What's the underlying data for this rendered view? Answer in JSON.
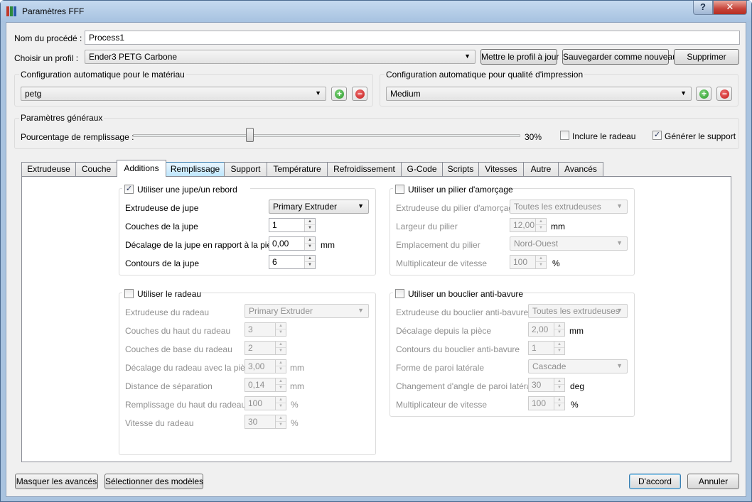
{
  "window": {
    "title": "Paramètres FFF",
    "help_label": "?",
    "close_label": "✕",
    "icon_colors": [
      "#c0392b",
      "#2e8b3d",
      "#2a5aa8"
    ]
  },
  "process": {
    "name_label": "Nom du procédé :",
    "name_value": "Process1",
    "profile_label": "Choisir un profil :",
    "profile_value": "Ender3 PETG Carbone",
    "update_button": "Mettre le profil à jour",
    "save_new_button": "Sauvegarder comme nouveau",
    "delete_button": "Supprimer"
  },
  "material": {
    "title": "Configuration automatique pour le matériau",
    "value": "petg"
  },
  "quality": {
    "title": "Configuration automatique pour qualité d'impression",
    "value": "Medium"
  },
  "general": {
    "title": "Paramètres généraux",
    "infill_label": "Pourcentage de remplissage :",
    "infill_value": "30%",
    "infill_percent": 30,
    "raft_label": "Inclure le radeau",
    "raft_checked": false,
    "support_label": "Générer le support",
    "support_checked": true
  },
  "tabs": [
    {
      "label": "Extrudeuse"
    },
    {
      "label": "Couche"
    },
    {
      "label": "Additions"
    },
    {
      "label": "Remplissage"
    },
    {
      "label": "Support"
    },
    {
      "label": "Température"
    },
    {
      "label": "Refroidissement"
    },
    {
      "label": "G-Code"
    },
    {
      "label": "Scripts"
    },
    {
      "label": "Vitesses"
    },
    {
      "label": "Autre"
    },
    {
      "label": "Avancés"
    }
  ],
  "active_tab": "Additions",
  "skirt": {
    "title": "Utiliser une jupe/un rebord",
    "checked": true,
    "extruder_label": "Extrudeuse de jupe",
    "extruder_value": "Primary Extruder",
    "layers_label": "Couches de la jupe",
    "layers_value": "1",
    "offset_label": "Décalage de la jupe en rapport à la pièce",
    "offset_value": "0,00",
    "offset_unit": "mm",
    "outlines_label": "Contours de la jupe",
    "outlines_value": "6"
  },
  "prime_pillar": {
    "title": "Utiliser un pilier d'amorçage",
    "checked": false,
    "extruder_label": "Extrudeuse du pilier d'amorçage",
    "extruder_value": "Toutes les extrudeuses",
    "width_label": "Largeur du pilier",
    "width_value": "12,00",
    "width_unit": "mm",
    "location_label": "Emplacement du pilier",
    "location_value": "Nord-Ouest",
    "speed_label": "Multiplicateur de vitesse",
    "speed_value": "100",
    "speed_unit": "%"
  },
  "raft": {
    "title": "Utiliser le radeau",
    "checked": false,
    "extruder_label": "Extrudeuse du radeau",
    "extruder_value": "Primary Extruder",
    "top_layers_label": "Couches du haut du radeau",
    "top_layers_value": "3",
    "base_layers_label": "Couches de base du radeau",
    "base_layers_value": "2",
    "offset_label": "Décalage du radeau avec la pièce",
    "offset_value": "3,00",
    "offset_unit": "mm",
    "separation_label": "Distance de séparation",
    "separation_value": "0,14",
    "separation_unit": "mm",
    "top_infill_label": "Remplissage du haut du radeau",
    "top_infill_value": "100",
    "top_infill_unit": "%",
    "speed_label": "Vitesse du radeau",
    "speed_value": "30",
    "speed_unit": "%"
  },
  "ooze_shield": {
    "title": "Utiliser un bouclier anti-bavure",
    "checked": false,
    "extruder_label": "Extrudeuse du bouclier anti-bavure",
    "extruder_value": "Toutes les extrudeuses",
    "offset_label": "Décalage depuis la pièce",
    "offset_value": "2,00",
    "offset_unit": "mm",
    "outlines_label": "Contours du bouclier anti-bavure",
    "outlines_value": "1",
    "sidewall_label": "Forme de paroi latérale",
    "sidewall_value": "Cascade",
    "angle_label": "Changement d'angle de paroi latérale",
    "angle_value": "30",
    "angle_unit": "deg",
    "speed_label": "Multiplicateur de vitesse",
    "speed_value": "100",
    "speed_unit": "%"
  },
  "footer": {
    "hide_advanced": "Masquer les avancés",
    "select_models": "Sélectionner des modèles",
    "ok": "D'accord",
    "cancel": "Annuler"
  }
}
